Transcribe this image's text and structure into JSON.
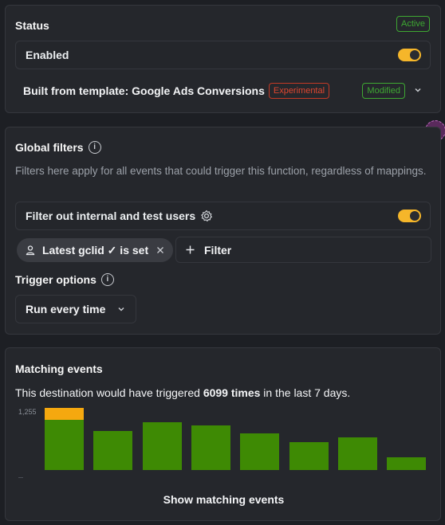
{
  "status": {
    "title": "Status",
    "badge": "Active",
    "enabled_label": "Enabled",
    "enabled_on": true,
    "template_prefix": "Built from template: ",
    "template_name": "Google Ads Conversions",
    "experimental_tag": "Experimental",
    "modified_tag": "Modified"
  },
  "filters": {
    "title": "Global filters",
    "description": "Filters here apply for all events that could trigger this function, regardless of mappings.",
    "internal_label": "Filter out internal and test users",
    "internal_on": true,
    "chip_label": "Latest gclid ✓ is set",
    "add_filter_label": "Filter",
    "trigger_title": "Trigger options",
    "trigger_value": "Run every time"
  },
  "matching": {
    "title": "Matching events",
    "summary_prefix": "This destination would have triggered ",
    "summary_count": "6099 times",
    "summary_suffix": " in the last 7 days.",
    "show_button": "Show matching events"
  },
  "chart_data": {
    "type": "bar",
    "y_tick_label": "1,255",
    "ylim": [
      0,
      1255
    ],
    "categories": [
      "",
      "",
      "",
      "",
      "",
      "",
      "",
      ""
    ],
    "series": [
      {
        "values": [
          1020,
          790,
          970,
          900,
          740,
          560,
          660,
          260
        ]
      },
      {
        "values": [
          235,
          0,
          0,
          0,
          0,
          0,
          0,
          0
        ]
      }
    ]
  },
  "colors": {
    "accent": "#f5b62a",
    "green": "#3e8a04",
    "orange": "#f5a80f",
    "danger": "#e0462f"
  }
}
